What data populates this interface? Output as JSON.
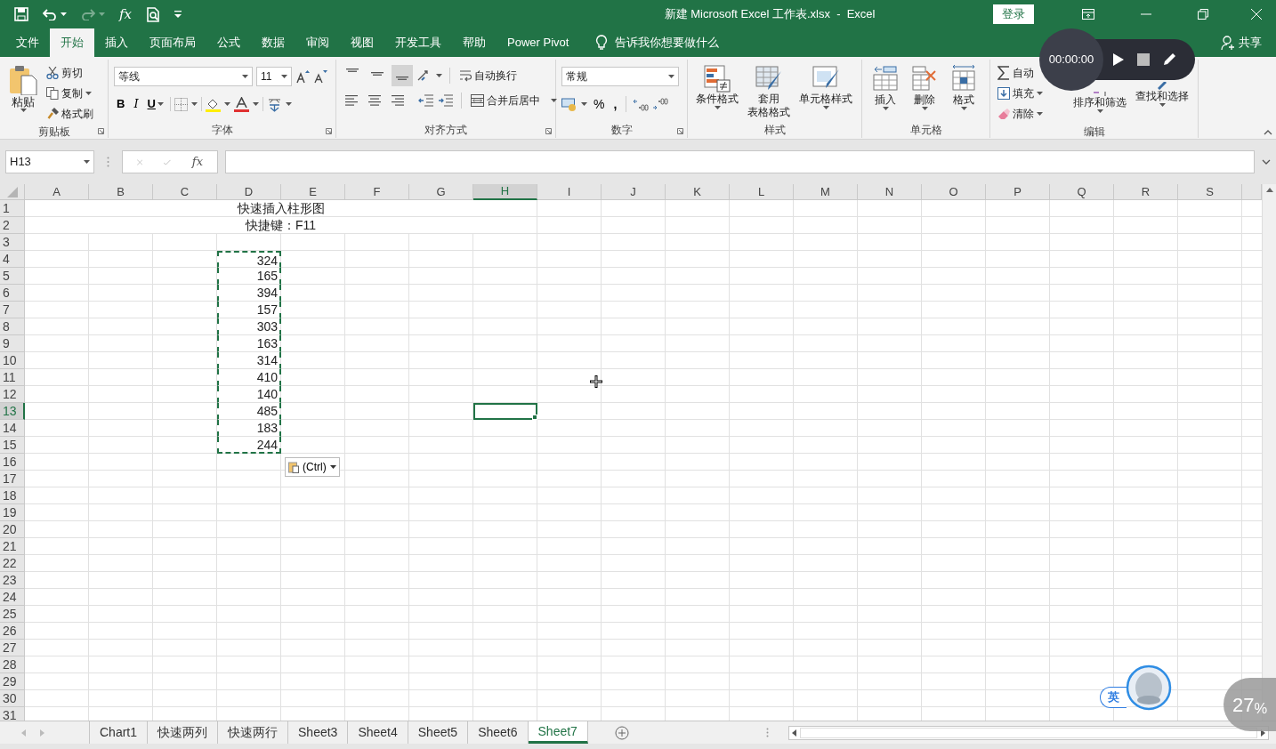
{
  "window": {
    "title": "新建 Microsoft Excel 工作表.xlsx  -  Excel",
    "sign_in": "登录"
  },
  "quick_access": {
    "function": "fx",
    "redo_disabled": true
  },
  "ribbon_tabs": [
    {
      "label": "文件",
      "selected": false
    },
    {
      "label": "开始",
      "selected": true
    },
    {
      "label": "插入",
      "selected": false
    },
    {
      "label": "页面布局",
      "selected": false
    },
    {
      "label": "公式",
      "selected": false
    },
    {
      "label": "数据",
      "selected": false
    },
    {
      "label": "审阅",
      "selected": false
    },
    {
      "label": "视图",
      "selected": false
    },
    {
      "label": "开发工具",
      "selected": false
    },
    {
      "label": "帮助",
      "selected": false
    },
    {
      "label": "Power Pivot",
      "selected": false
    }
  ],
  "tell_me": "告诉我你想要做什么",
  "share": "共享",
  "clipboard": {
    "title": "剪贴板",
    "paste": "粘贴",
    "cut": "剪切",
    "copy": "复制",
    "format_painter": "格式刷"
  },
  "font": {
    "title": "字体",
    "font_name": "等线",
    "font_size": "11",
    "bold": "B",
    "italic": "I",
    "underline": "U"
  },
  "alignment": {
    "title": "对齐方式",
    "vertical": [
      {
        "selected": false
      },
      {
        "selected": false
      },
      {
        "selected": true
      }
    ],
    "wrap": "自动换行",
    "merge": "合并后居中"
  },
  "number": {
    "title": "数字",
    "format": "常规",
    "percent": "%",
    "comma": ","
  },
  "styles": {
    "title": "样式",
    "items": [
      {
        "lines": [
          "条件格式"
        ],
        "kind": "conditional"
      },
      {
        "lines": [
          "套用",
          "表格格式"
        ],
        "kind": "table"
      },
      {
        "lines": [
          "单元格样式"
        ],
        "kind": "cellstyle"
      }
    ]
  },
  "cells_group": {
    "title": "单元格",
    "items": [
      {
        "label": "插入",
        "kind": "insert"
      },
      {
        "label": "删除",
        "kind": "delete"
      },
      {
        "label": "格式",
        "kind": "format"
      }
    ]
  },
  "editing": {
    "title": "编辑",
    "autosum": "自动",
    "fill": "填充",
    "clear": "清除",
    "sort": "排序和筛选",
    "find": "查找和选择"
  },
  "recorder": {
    "time": "00:00:00"
  },
  "formula_bar": {
    "name_box": "H13",
    "function": "fx",
    "edit_disabled": true
  },
  "sheet": {
    "columns": [
      {
        "label": "A",
        "selected": false
      },
      {
        "label": "B",
        "selected": false
      },
      {
        "label": "C",
        "selected": false
      },
      {
        "label": "D",
        "selected": false
      },
      {
        "label": "E",
        "selected": false
      },
      {
        "label": "F",
        "selected": false
      },
      {
        "label": "G",
        "selected": false
      },
      {
        "label": "H",
        "selected": true
      },
      {
        "label": "I",
        "selected": false
      },
      {
        "label": "J",
        "selected": false
      },
      {
        "label": "K",
        "selected": false
      },
      {
        "label": "L",
        "selected": false
      },
      {
        "label": "M",
        "selected": false
      },
      {
        "label": "N",
        "selected": false
      },
      {
        "label": "O",
        "selected": false
      },
      {
        "label": "P",
        "selected": false
      },
      {
        "label": "Q",
        "selected": false
      },
      {
        "label": "R",
        "selected": false
      },
      {
        "label": "S",
        "selected": false
      }
    ],
    "rows": [
      {
        "label": "1",
        "selected": false,
        "merged_text": "快速插入柱形图"
      },
      {
        "label": "2",
        "selected": false,
        "merged_text": "快捷键：F11"
      },
      {
        "label": "3",
        "selected": false
      },
      {
        "label": "4",
        "selected": false,
        "column_d": "324",
        "copied": true
      },
      {
        "label": "5",
        "selected": false,
        "column_d": "165",
        "copied": true
      },
      {
        "label": "6",
        "selected": false,
        "column_d": "394",
        "copied": true
      },
      {
        "label": "7",
        "selected": false,
        "column_d": "157",
        "copied": true
      },
      {
        "label": "8",
        "selected": false,
        "column_d": "303",
        "copied": true
      },
      {
        "label": "9",
        "selected": false,
        "column_d": "163",
        "copied": true
      },
      {
        "label": "10",
        "selected": false,
        "column_d": "314",
        "copied": true
      },
      {
        "label": "11",
        "selected": false,
        "column_d": "410",
        "copied": true
      },
      {
        "label": "12",
        "selected": false,
        "column_d": "140",
        "copied": true
      },
      {
        "label": "13",
        "selected": true,
        "column_d": "485",
        "copied": true
      },
      {
        "label": "14",
        "selected": false,
        "column_d": "183",
        "copied": true
      },
      {
        "label": "15",
        "selected": false,
        "column_d": "244",
        "copied": true
      },
      {
        "label": "16",
        "selected": false
      },
      {
        "label": "17",
        "selected": false
      },
      {
        "label": "18",
        "selected": false
      },
      {
        "label": "19",
        "selected": false
      },
      {
        "label": "20",
        "selected": false
      },
      {
        "label": "21",
        "selected": false
      },
      {
        "label": "22",
        "selected": false
      },
      {
        "label": "23",
        "selected": false
      },
      {
        "label": "24",
        "selected": false
      },
      {
        "label": "25",
        "selected": false
      },
      {
        "label": "26",
        "selected": false
      },
      {
        "label": "27",
        "selected": false
      },
      {
        "label": "28",
        "selected": false
      },
      {
        "label": "29",
        "selected": false
      },
      {
        "label": "30",
        "selected": false
      },
      {
        "label": "31",
        "selected": false
      }
    ]
  },
  "paste_options": {
    "label": "(Ctrl)"
  },
  "sheet_tabs": [
    {
      "label": "Chart1",
      "selected": false
    },
    {
      "label": "快速两列",
      "selected": false
    },
    {
      "label": "快速两行",
      "selected": false
    },
    {
      "label": "Sheet3",
      "selected": false
    },
    {
      "label": "Sheet4",
      "selected": false
    },
    {
      "label": "Sheet5",
      "selected": false
    },
    {
      "label": "Sheet6",
      "selected": false
    },
    {
      "label": "Sheet7",
      "selected": true
    }
  ],
  "ime": {
    "label": "英"
  },
  "zoom_badge": {
    "label": "27$_{%}$"
  }
}
